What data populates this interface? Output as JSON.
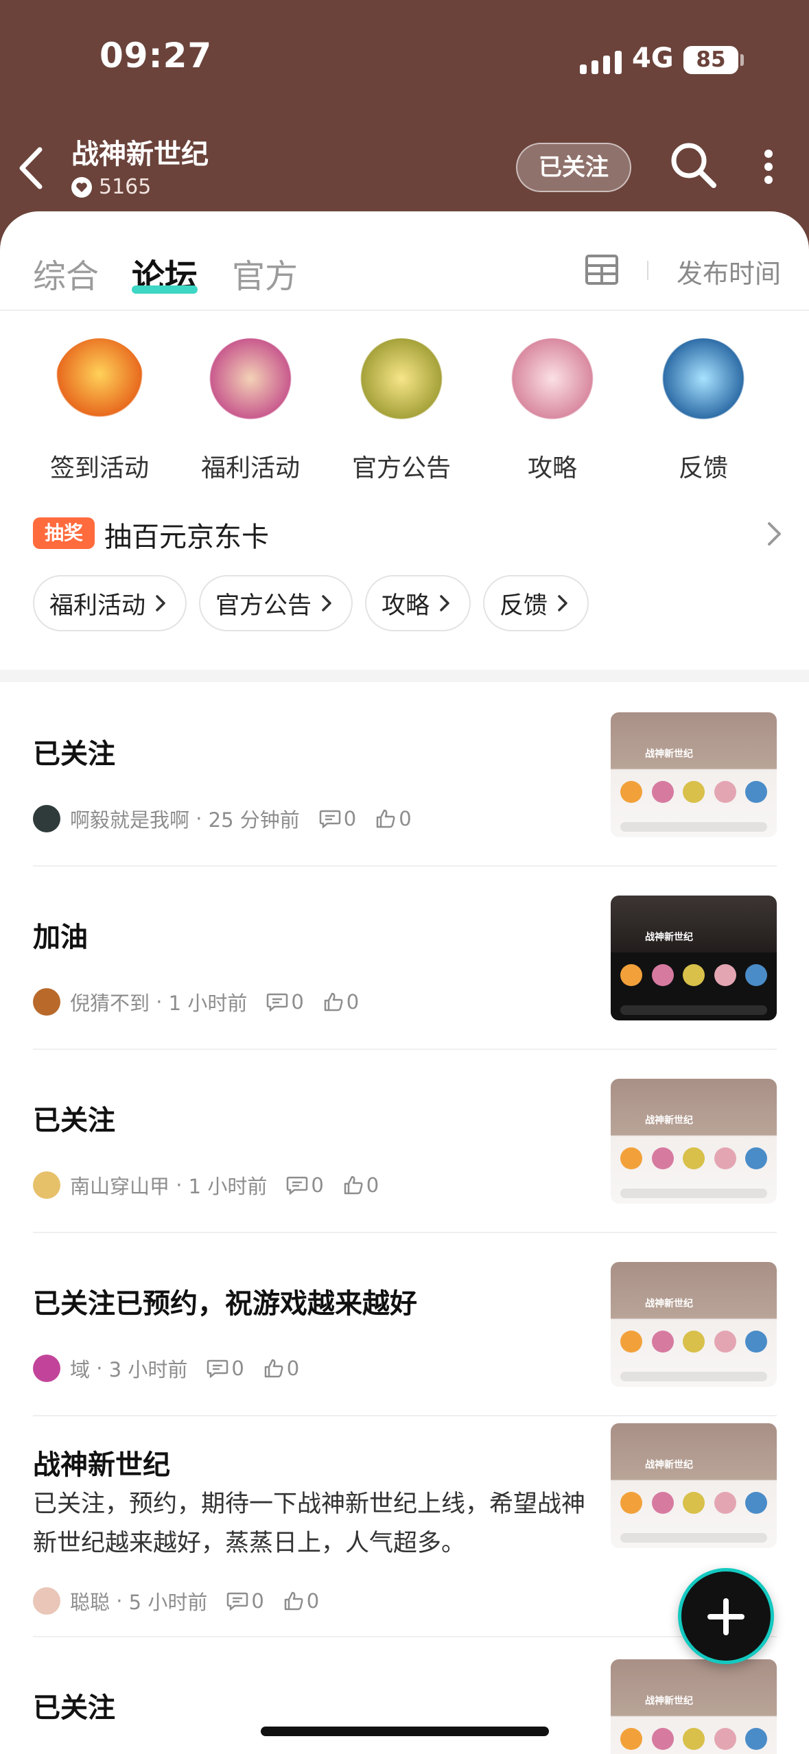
{
  "status_bar": {
    "time": "09:27",
    "network": "4G",
    "battery": "85"
  },
  "header": {
    "title": "战神新世纪",
    "likes": "5165",
    "follow_label": "已关注"
  },
  "tabs": [
    {
      "label": "综合"
    },
    {
      "label": "论坛"
    },
    {
      "label": "官方"
    }
  ],
  "sort_label": "发布时间",
  "categories": [
    {
      "label": "签到活动",
      "color": "#f2a13a"
    },
    {
      "label": "福利活动",
      "color": "#d77aa0"
    },
    {
      "label": "官方公告",
      "color": "#d8c04a"
    },
    {
      "label": "攻略",
      "color": "#e4a5b2"
    },
    {
      "label": "反馈",
      "color": "#4a8cc8"
    }
  ],
  "lottery": {
    "tag": "抽奖",
    "text": "抽百元京东卡"
  },
  "chips": [
    "福利活动",
    "官方公告",
    "攻略",
    "反馈"
  ],
  "posts": [
    {
      "title": "已关注",
      "body": "",
      "user": "啊毅就是我啊",
      "time": "25 分钟前",
      "comments": "0",
      "likes": "0",
      "avatar_color": "#2f3b3a",
      "thumb": "light"
    },
    {
      "title": "加油",
      "body": "",
      "user": "倪猜不到",
      "time": "1 小时前",
      "comments": "0",
      "likes": "0",
      "avatar_color": "#b9692a",
      "thumb": "dark"
    },
    {
      "title": "已关注",
      "body": "",
      "user": "南山穿山甲",
      "time": "1 小时前",
      "comments": "0",
      "likes": "0",
      "avatar_color": "#e7c06a",
      "thumb": "light"
    },
    {
      "title": "已关注已预约，祝游戏越来越好",
      "body": "",
      "user": "域",
      "time": "3 小时前",
      "comments": "0",
      "likes": "0",
      "avatar_color": "#c2449a",
      "thumb": "light"
    },
    {
      "title": "战神新世纪",
      "body": "已关注，预约，期待一下战神新世纪上线，希望战神新世纪越来越好，蒸蒸日上，人气超多。",
      "user": "聪聪",
      "time": "5 小时前",
      "comments": "0",
      "likes": "0",
      "avatar_color": "#e9c6b8",
      "thumb": "light"
    },
    {
      "title": "已关注",
      "body": "",
      "user": "",
      "time": "",
      "comments": "",
      "likes": "",
      "avatar_color": "#9a8f8a",
      "thumb": "light"
    }
  ],
  "thumb_title": "战神新世纪",
  "icons": {
    "back": "chevron-left-icon",
    "search": "search-icon",
    "more": "more-vertical-icon",
    "layout": "grid-layout-icon",
    "comment": "comment-icon",
    "like": "thumbs-up-icon",
    "add": "plus-icon"
  },
  "colors": {
    "header_bg": "#6b433b",
    "accent": "#3ed6c4",
    "lottery_tag": "#ff6b3d"
  }
}
